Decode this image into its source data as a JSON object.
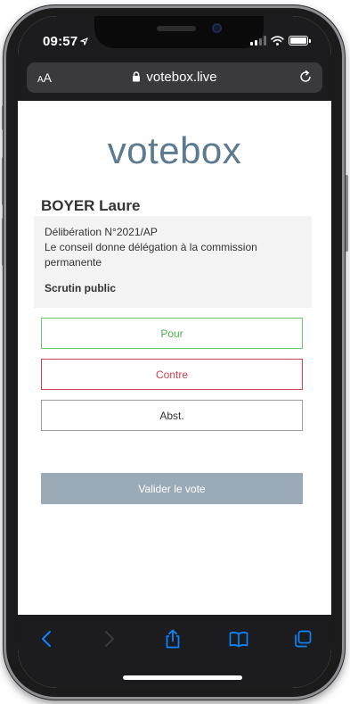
{
  "status_bar": {
    "time": "09:57"
  },
  "browser": {
    "text_size_label_small": "A",
    "text_size_label_large": "A",
    "domain": "votebox.live"
  },
  "page": {
    "logo": "votebox",
    "voter_name": "BOYER Laure",
    "motion": {
      "number": "Délibération N°2021/AP",
      "text": "Le conseil donne délégation à la commission permanente",
      "ballot_type": "Scrutin public"
    },
    "options": {
      "pour": "Pour",
      "contre": "Contre",
      "abst": "Abst."
    },
    "submit_label": "Valider le vote"
  },
  "colors": {
    "logo": "#5c7a90",
    "pour": "#4caf50",
    "contre": "#d13f52",
    "submit_disabled": "#9aaab6",
    "toolbar_icon": "#0a84ff"
  }
}
